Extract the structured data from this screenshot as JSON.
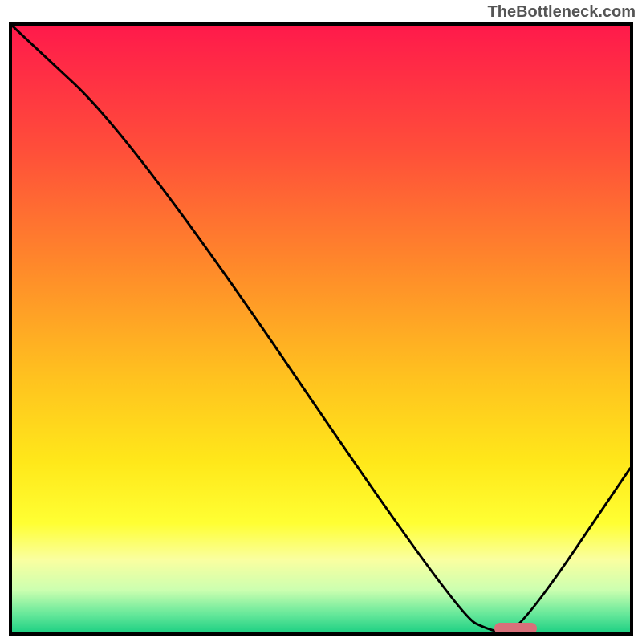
{
  "watermark": "TheBottleneck.com",
  "chart_data": {
    "type": "line",
    "title": "",
    "xlabel": "",
    "ylabel": "",
    "x_range": [
      0,
      100
    ],
    "y_range": [
      0,
      100
    ],
    "series": [
      {
        "name": "bottleneck-curve",
        "x": [
          0,
          20,
          72,
          78,
          82,
          100
        ],
        "y": [
          100,
          81,
          3,
          0,
          0,
          27
        ]
      }
    ],
    "minimum_zone": {
      "x_start": 78,
      "x_end": 85,
      "y": 0
    },
    "background": {
      "type": "vertical-gradient",
      "stops": [
        {
          "pos": 0.0,
          "color": "#ff1a4b"
        },
        {
          "pos": 0.2,
          "color": "#ff4d3a"
        },
        {
          "pos": 0.4,
          "color": "#ff8a2a"
        },
        {
          "pos": 0.58,
          "color": "#ffc21f"
        },
        {
          "pos": 0.72,
          "color": "#ffe81a"
        },
        {
          "pos": 0.82,
          "color": "#ffff33"
        },
        {
          "pos": 0.88,
          "color": "#faffa0"
        },
        {
          "pos": 0.93,
          "color": "#ccffb0"
        },
        {
          "pos": 0.97,
          "color": "#66e89a"
        },
        {
          "pos": 1.0,
          "color": "#1fd084"
        }
      ]
    }
  }
}
